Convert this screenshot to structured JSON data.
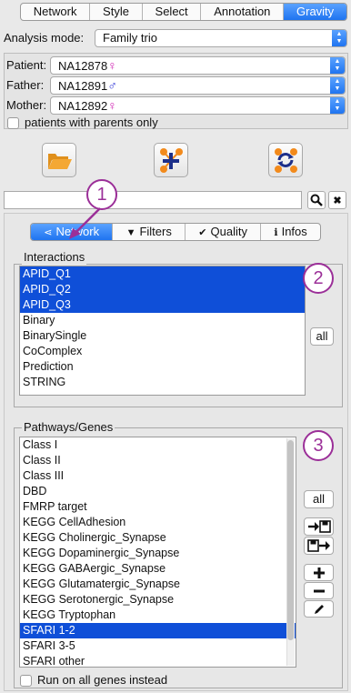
{
  "top_tabs": [
    "Network",
    "Style",
    "Select",
    "Annotation",
    "Gravity"
  ],
  "top_tab_active_index": 4,
  "analysis": {
    "label": "Analysis mode:",
    "value": "Family trio"
  },
  "patients": [
    {
      "label": "Patient:",
      "value": "NA12878",
      "sex_symbol": "♀"
    },
    {
      "label": "Father:",
      "value": "NA12891",
      "sex_symbol": "♂"
    },
    {
      "label": "Mother:",
      "value": "NA12892",
      "sex_symbol": "♀"
    }
  ],
  "parents_only_label": "patients with parents only",
  "toolbar_icons": [
    "folder-open-icon",
    "network-add-icon",
    "network-refresh-icon"
  ],
  "search": {
    "search_glyph": "🔍",
    "clear_glyph": "✖"
  },
  "sub_tabs": [
    {
      "label": "Network",
      "icon": "share-icon",
      "glyph": "⋖"
    },
    {
      "label": "Filters",
      "icon": "filter-icon",
      "glyph": "▼"
    },
    {
      "label": "Quality",
      "icon": "check-circle-icon",
      "glyph": "✔"
    },
    {
      "label": "Infos",
      "icon": "info-icon",
      "glyph": "ℹ"
    }
  ],
  "sub_tab_active_index": 0,
  "interactions": {
    "title": "Interactions",
    "items": [
      "APID_Q1",
      "APID_Q2",
      "APID_Q3",
      "Binary",
      "BinarySingle",
      "CoComplex",
      "Prediction",
      "STRING"
    ],
    "selected": [
      0,
      1,
      2
    ],
    "all_label": "all"
  },
  "pathways": {
    "title": "Pathways/Genes",
    "items": [
      "Class I",
      "Class II",
      "Class III",
      "DBD",
      "FMRP target",
      "KEGG CellAdhesion",
      "KEGG Cholinergic_Synapse",
      "KEGG Dopaminergic_Synapse",
      "KEGG GABAergic_Synapse",
      "KEGG Glutamatergic_Synapse",
      "KEGG Serotonergic_Synapse",
      "KEGG Tryptophan",
      "SFARI 1-2",
      "SFARI 3-5",
      "SFARI other"
    ],
    "selected": [
      12
    ],
    "all_label": "all",
    "run_all_label": "Run on all genes instead"
  },
  "callouts": [
    "1",
    "2",
    "3"
  ],
  "colors": {
    "accent": "#1f74f0",
    "selection": "#0f4fd8",
    "callout": "#9b2f98",
    "female": "#d01fb2",
    "male": "#2a30d6"
  }
}
